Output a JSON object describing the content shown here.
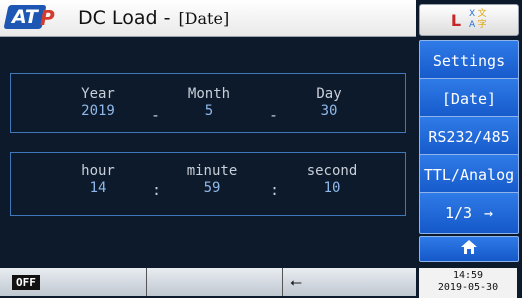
{
  "header": {
    "app_name": "DC Load",
    "separator": "-",
    "page": "[Date]"
  },
  "language_icon": {
    "latin": "L",
    "chars": [
      "X",
      "文",
      "A",
      "字"
    ]
  },
  "date": {
    "year": {
      "label": "Year",
      "value": "2019"
    },
    "month": {
      "label": "Month",
      "value": "5"
    },
    "day": {
      "label": "Day",
      "value": "30"
    },
    "sep": "-"
  },
  "time": {
    "hour": {
      "label": "hour",
      "value": "14"
    },
    "minute": {
      "label": "minute",
      "value": "59"
    },
    "second": {
      "label": "second",
      "value": "10"
    },
    "sep": ":"
  },
  "sidebar": {
    "settings": "Settings",
    "date": "[Date]",
    "rs232": "RS232/485",
    "ttl": "TTL/Analog",
    "page": "1/3",
    "next_arrow": "→",
    "home_icon": "home-icon"
  },
  "statusbar": {
    "output_state": "OFF",
    "usb_icon": "usb-icon"
  },
  "clock": {
    "time": "14:59",
    "date": "2019-05-30"
  }
}
